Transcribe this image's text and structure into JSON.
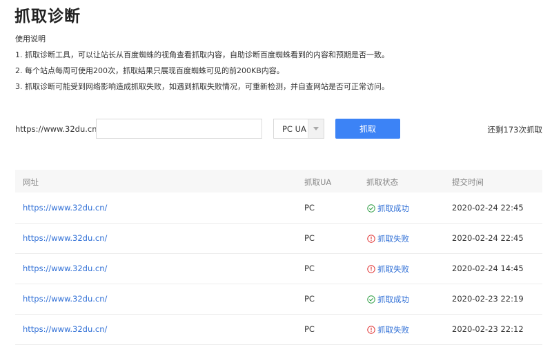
{
  "page": {
    "title": "抓取诊断"
  },
  "usage": {
    "heading": "使用说明",
    "lines": [
      "1. 抓取诊断工具，可以让站长从百度蜘蛛的视角查看抓取内容，自助诊断百度蜘蛛看到的内容和预期是否一致。",
      "2. 每个站点每周可使用200次，抓取结果只展现百度蜘蛛可见的前200KB内容。",
      "3. 抓取诊断可能受到网络影响造成抓取失败，如遇到抓取失败情况，可重新检测，并自查网站是否可正常访问。"
    ]
  },
  "form": {
    "url_prefix": "https://www.32du.cn/",
    "url_value": "",
    "ua_selected": "PC UA",
    "fetch_button": "抓取",
    "remaining": "还剩173次抓取"
  },
  "table": {
    "columns": [
      "网址",
      "抓取UA",
      "抓取状态",
      "提交时间"
    ],
    "rows": [
      {
        "url": "https://www.32du.cn/",
        "ua": "PC",
        "status": "抓取成功",
        "status_icon": "check-circle-icon",
        "time": "2020-02-24 22:45"
      },
      {
        "url": "https://www.32du.cn/",
        "ua": "PC",
        "status": "抓取失败",
        "status_icon": "exclamation-circle-icon",
        "time": "2020-02-24 22:45"
      },
      {
        "url": "https://www.32du.cn/",
        "ua": "PC",
        "status": "抓取失败",
        "status_icon": "exclamation-circle-icon",
        "time": "2020-02-24 14:45"
      },
      {
        "url": "https://www.32du.cn/",
        "ua": "PC",
        "status": "抓取成功",
        "status_icon": "check-circle-icon",
        "time": "2020-02-23 22:19"
      },
      {
        "url": "https://www.32du.cn/",
        "ua": "PC",
        "status": "抓取失败",
        "status_icon": "exclamation-circle-icon",
        "time": "2020-02-23 22:12"
      }
    ]
  },
  "colors": {
    "primary": "#3c83f6",
    "link": "#2f6fd6",
    "success": "#2f9e44",
    "failure": "#e03131"
  }
}
